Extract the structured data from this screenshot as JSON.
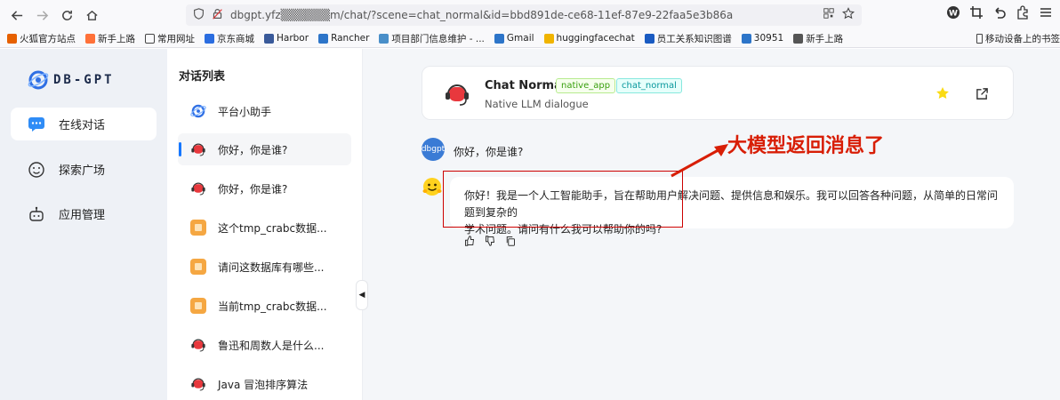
{
  "browser": {
    "url": "dbgpt.yfz▒▒▒▒▒▒m/chat/?scene=chat_normal&id=bbd891de-ce68-11ef-87e9-22faa5e3b86a",
    "bookmarks": [
      "火狐官方站点",
      "新手上路",
      "常用网址",
      "京东商城",
      "Harbor",
      "Rancher",
      "项目部门信息维护 - ...",
      "Gmail",
      "huggingfacechat",
      "员工关系知识图谱",
      "30951",
      "新手上路"
    ],
    "bookmark_colors": [
      "#e66000",
      "#ff7139",
      "#4a4a4a",
      "#2b6de0",
      "#3a5a9a",
      "#2d75c9",
      "#4a8fc9",
      "#2d75c9",
      "#f0b400",
      "#1a5bc2",
      "#2d75c9",
      "#555555"
    ],
    "mobile_bookmarks": "移动设备上的书签"
  },
  "sidebar": {
    "logo": "DB-GPT",
    "items": [
      {
        "label": "在线对话",
        "icon": "chat-bubble-icon"
      },
      {
        "label": "探索广场",
        "icon": "smile-icon"
      },
      {
        "label": "应用管理",
        "icon": "robot-icon"
      }
    ]
  },
  "conversations": {
    "title": "对话列表",
    "items": [
      {
        "label": "平台小助手",
        "icon": "assistant-logo-icon"
      },
      {
        "label": "你好，你是谁?",
        "icon": "chat-app-icon"
      },
      {
        "label": "你好，你是谁?",
        "icon": "chat-app-icon"
      },
      {
        "label": "这个tmp_crabc数据...",
        "icon": "database-app-icon"
      },
      {
        "label": "请问这数据库有哪些...",
        "icon": "database-app-icon"
      },
      {
        "label": "当前tmp_crabc数据...",
        "icon": "database-app-icon"
      },
      {
        "label": "鲁迅和周数人是什么...",
        "icon": "chat-app-icon"
      },
      {
        "label": "Java 冒泡排序算法",
        "icon": "chat-app-icon"
      }
    ]
  },
  "chat": {
    "header": {
      "title": "Chat Normal",
      "tags": [
        "native_app",
        "chat_normal"
      ],
      "subtitle": "Native LLM dialogue"
    },
    "user": {
      "avatar": "dbgpt",
      "message": "你好，你是谁?"
    },
    "bot": {
      "line1": "你好！我是一个人工智能助手，旨在帮助用户解决问题、提供信息和娱乐。我可以回答各种问题，从简单的日常问题到复杂的",
      "line2": "学术问题。请问有什么我可以帮助你的吗?"
    }
  },
  "annotation": {
    "text": "大模型返回消息了",
    "color": "#d81e06"
  },
  "colors": {
    "accent": "#1677ff",
    "tag_green": "#389e0d",
    "tag_cyan": "#08979c",
    "star": "#fadb14"
  }
}
